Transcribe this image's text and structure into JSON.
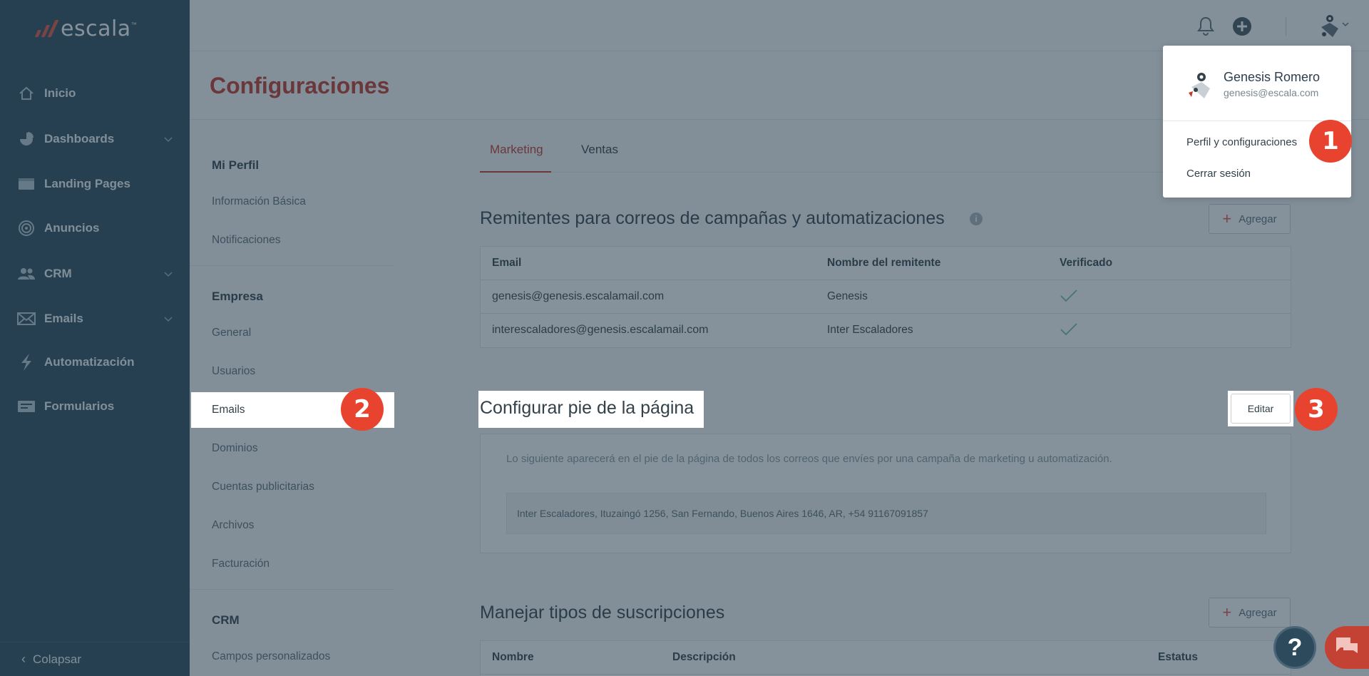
{
  "app": {
    "logo_text": "escala",
    "logo_tm": "™"
  },
  "sidebar": {
    "items": [
      {
        "label": "Inicio",
        "icon": "home-icon",
        "has_chevron": false
      },
      {
        "label": "Dashboards",
        "icon": "pie-chart-icon",
        "has_chevron": true
      },
      {
        "label": "Landing Pages",
        "icon": "landing-page-icon",
        "has_chevron": false
      },
      {
        "label": "Anuncios",
        "icon": "target-icon",
        "has_chevron": false
      },
      {
        "label": "CRM",
        "icon": "people-icon",
        "has_chevron": true
      },
      {
        "label": "Emails",
        "icon": "envelope-icon",
        "has_chevron": true
      },
      {
        "label": "Automatización",
        "icon": "lightning-icon",
        "has_chevron": false
      },
      {
        "label": "Formularios",
        "icon": "form-icon",
        "has_chevron": false
      }
    ],
    "collapse_label": "Colapsar"
  },
  "header": {
    "title": "Configuraciones"
  },
  "settings_nav": {
    "groups": [
      {
        "title": "Mi Perfil",
        "items": [
          "Información Básica",
          "Notificaciones"
        ]
      },
      {
        "title": "Empresa",
        "items": [
          "General",
          "Usuarios",
          "Emails",
          "Dominios",
          "Cuentas publicitarias",
          "Archivos",
          "Facturación"
        ]
      },
      {
        "title": "CRM",
        "items": [
          "Campos personalizados"
        ]
      }
    ],
    "active_item": "Emails"
  },
  "tabs": {
    "marketing": "Marketing",
    "ventas": "Ventas",
    "active": "Marketing"
  },
  "senders": {
    "title": "Remitentes para correos de campañas y automatizaciones",
    "add_label": "Agregar",
    "columns": [
      "Email",
      "Nombre del remitente",
      "Verificado"
    ],
    "rows": [
      {
        "email": "genesis@genesis.escalamail.com",
        "name": "Genesis",
        "verified": true
      },
      {
        "email": "interescaladores@genesis.escalamail.com",
        "name": "Inter Escaladores",
        "verified": true
      }
    ]
  },
  "footer_config": {
    "title": "Configurar pie de la página",
    "edit_label": "Editar",
    "description": "Lo siguiente aparecerá en el pie de la página de todos los correos que envíes por una campaña de marketing u automatización.",
    "value": "Inter Escaladores, Ituzaingó 1256, San Fernando, Buenos Aires 1646, AR, +54 91167091857"
  },
  "subscriptions": {
    "title": "Manejar tipos de suscripciones",
    "add_label": "Agregar",
    "columns": [
      "Nombre",
      "Descripción",
      "Estatus"
    ]
  },
  "user_menu": {
    "name": "Genesis Romero",
    "email": "genesis@escala.com",
    "items": [
      "Perfil y configuraciones",
      "Cerrar sesión"
    ]
  },
  "badges": [
    "1",
    "2",
    "3"
  ],
  "help_label": "?",
  "colors": {
    "sidebar_bg": "#2c4a5c",
    "accent": "#c0392b",
    "badge": "#e8432f"
  }
}
